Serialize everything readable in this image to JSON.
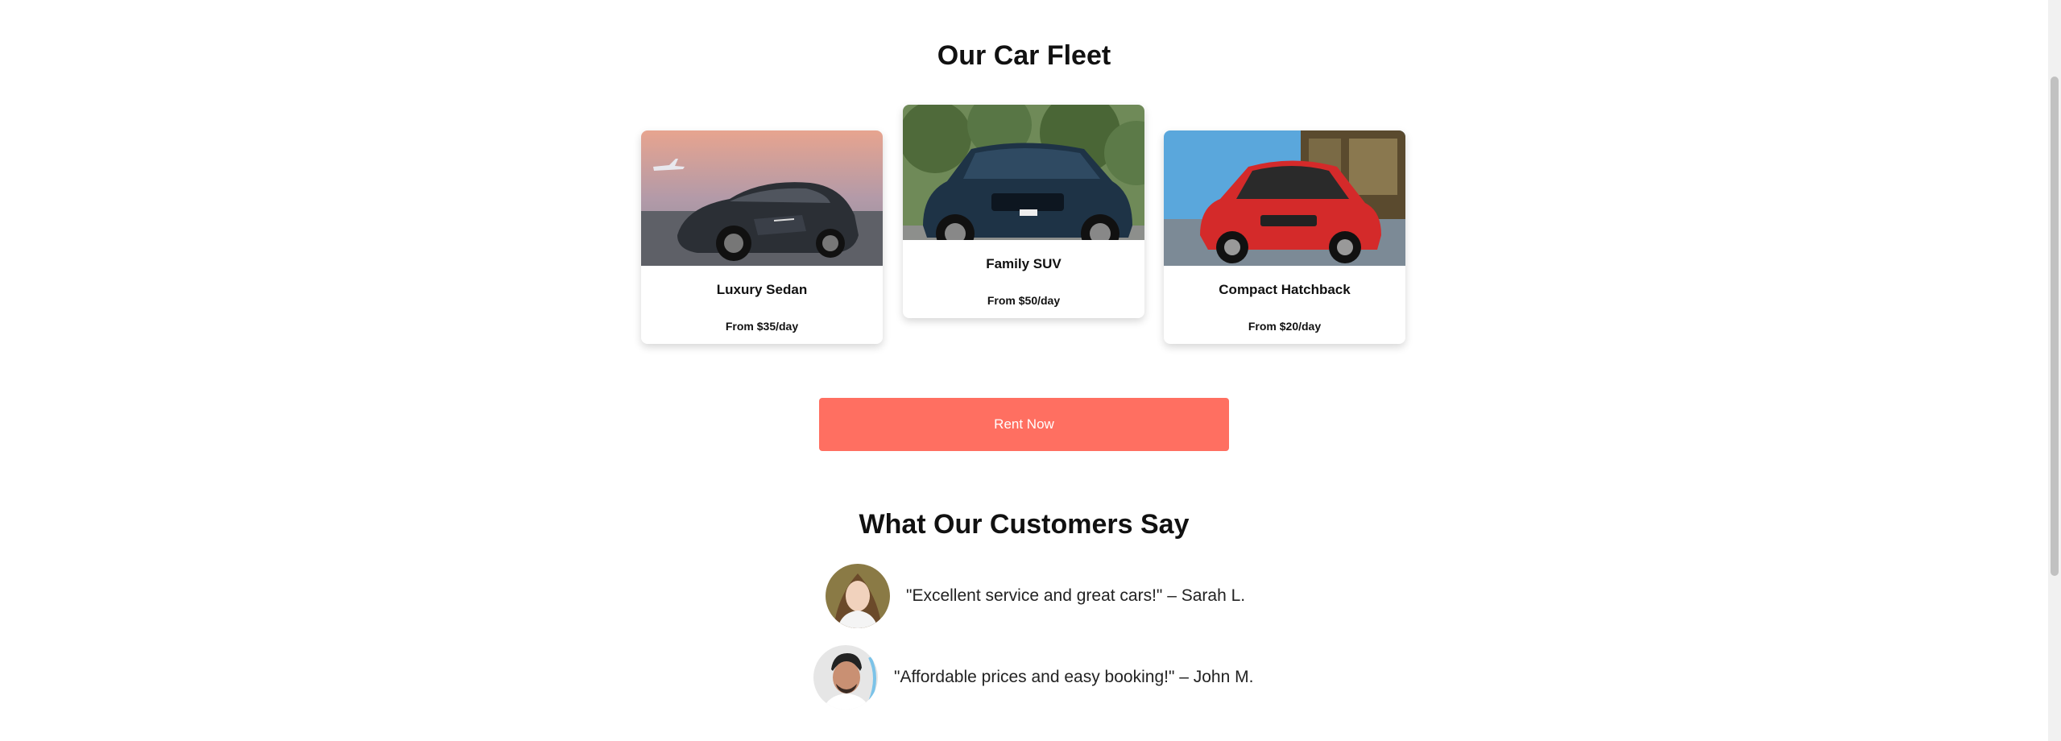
{
  "fleet": {
    "title": "Our Car Fleet",
    "cars": [
      {
        "name": "Luxury Sedan",
        "price": "From $35/day",
        "color": "#2b2f35",
        "sky": "#c98a8a"
      },
      {
        "name": "Family SUV",
        "price": "From $50/day",
        "color": "#1e3346",
        "sky": "#4c6b3c"
      },
      {
        "name": "Compact Hatchback",
        "price": "From $20/day",
        "color": "#d42a2a",
        "sky": "#4aa0d8"
      }
    ]
  },
  "cta": {
    "label": "Rent Now",
    "color": "#ff6f61"
  },
  "testimonials": {
    "title": "What Our Customers Say",
    "items": [
      {
        "quote": "\"Excellent service and great cars!\" – Sarah L."
      },
      {
        "quote": "\"Affordable prices and easy booking!\" – John M."
      }
    ]
  }
}
